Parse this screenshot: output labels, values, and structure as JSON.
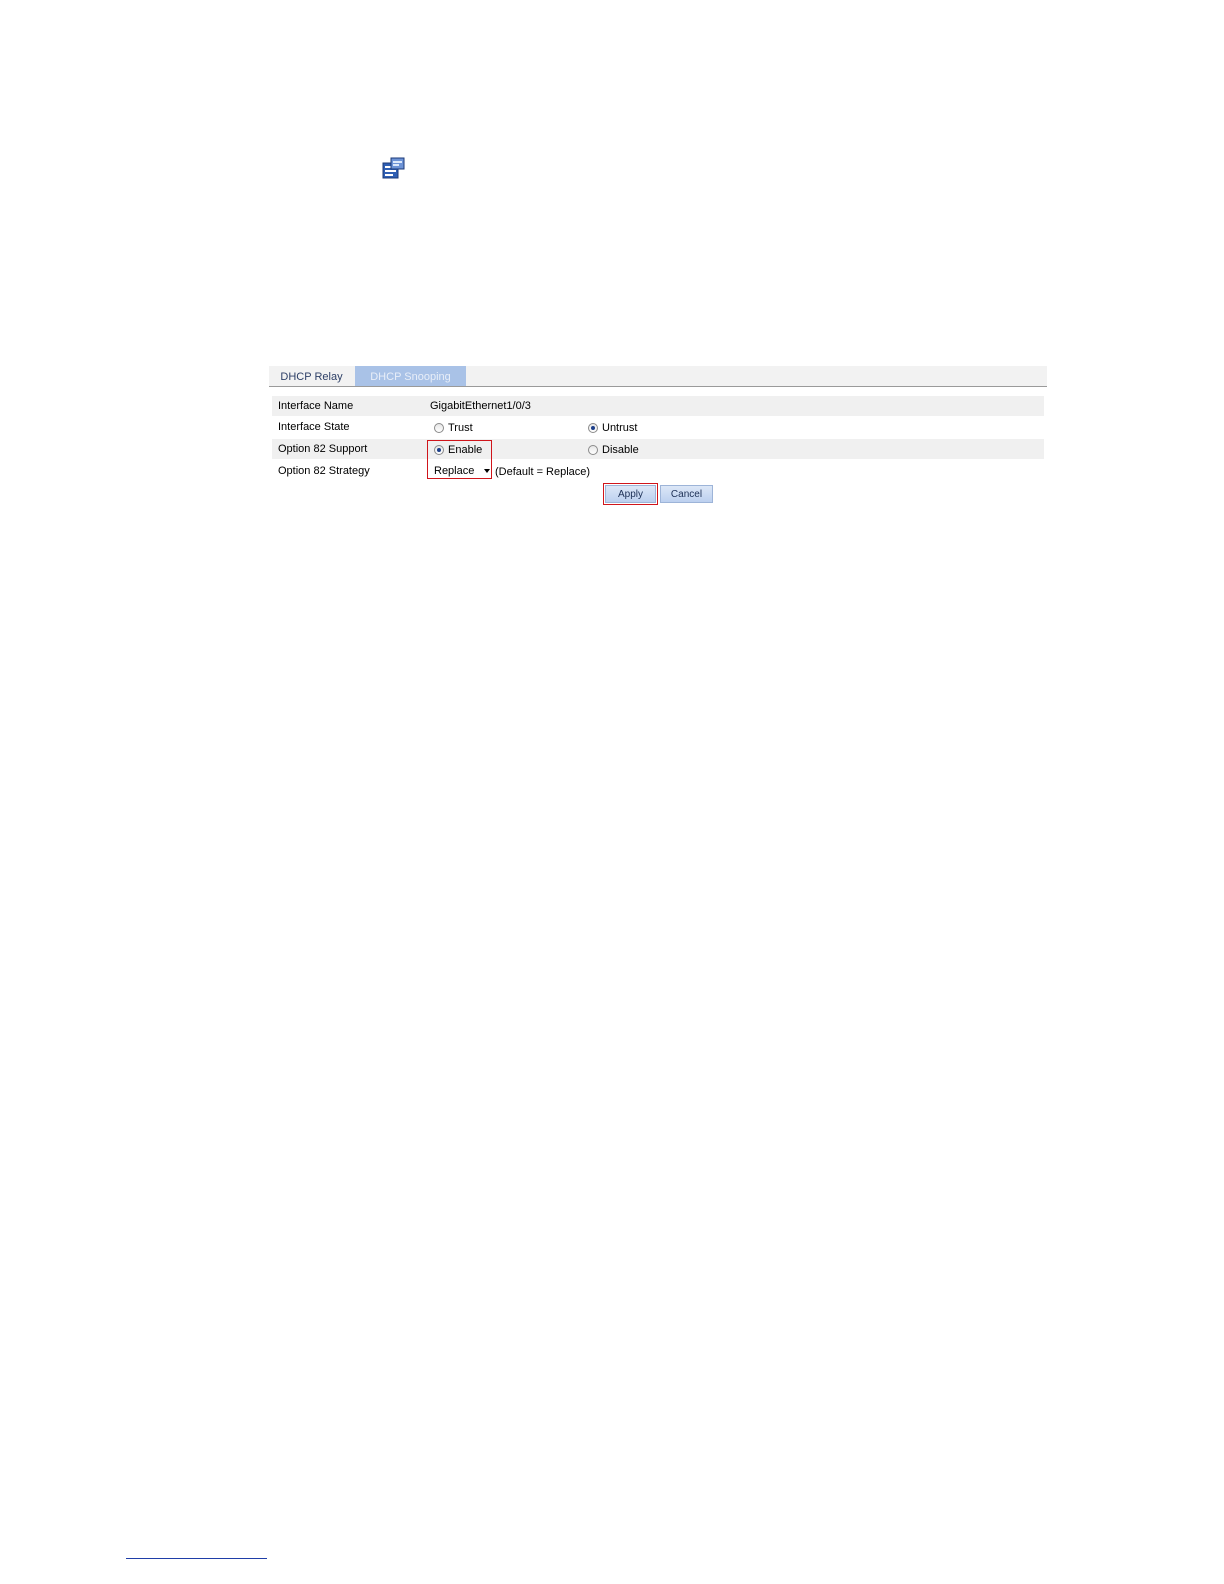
{
  "tabs": [
    {
      "label": "DHCP Relay",
      "active": false
    },
    {
      "label": "DHCP Snooping",
      "active": true
    }
  ],
  "form": {
    "interface_name": {
      "label": "Interface Name",
      "value": "GigabitEthernet1/0/3"
    },
    "interface_state": {
      "label": "Interface State",
      "options": [
        {
          "label": "Trust",
          "checked": false
        },
        {
          "label": "Untrust",
          "checked": true
        }
      ]
    },
    "option82_support": {
      "label": "Option 82 Support",
      "options": [
        {
          "label": "Enable",
          "checked": true
        },
        {
          "label": "Disable",
          "checked": false
        }
      ]
    },
    "option82_strategy": {
      "label": "Option 82 Strategy",
      "selected": "Replace",
      "hint": "(Default = Replace)"
    }
  },
  "buttons": {
    "apply": "Apply",
    "cancel": "Cancel"
  },
  "colors": {
    "active_tab": "#a9c2e7",
    "highlight": "#d0151b",
    "button": "#bcd0ef"
  },
  "icons": [
    "document-config-icon"
  ]
}
